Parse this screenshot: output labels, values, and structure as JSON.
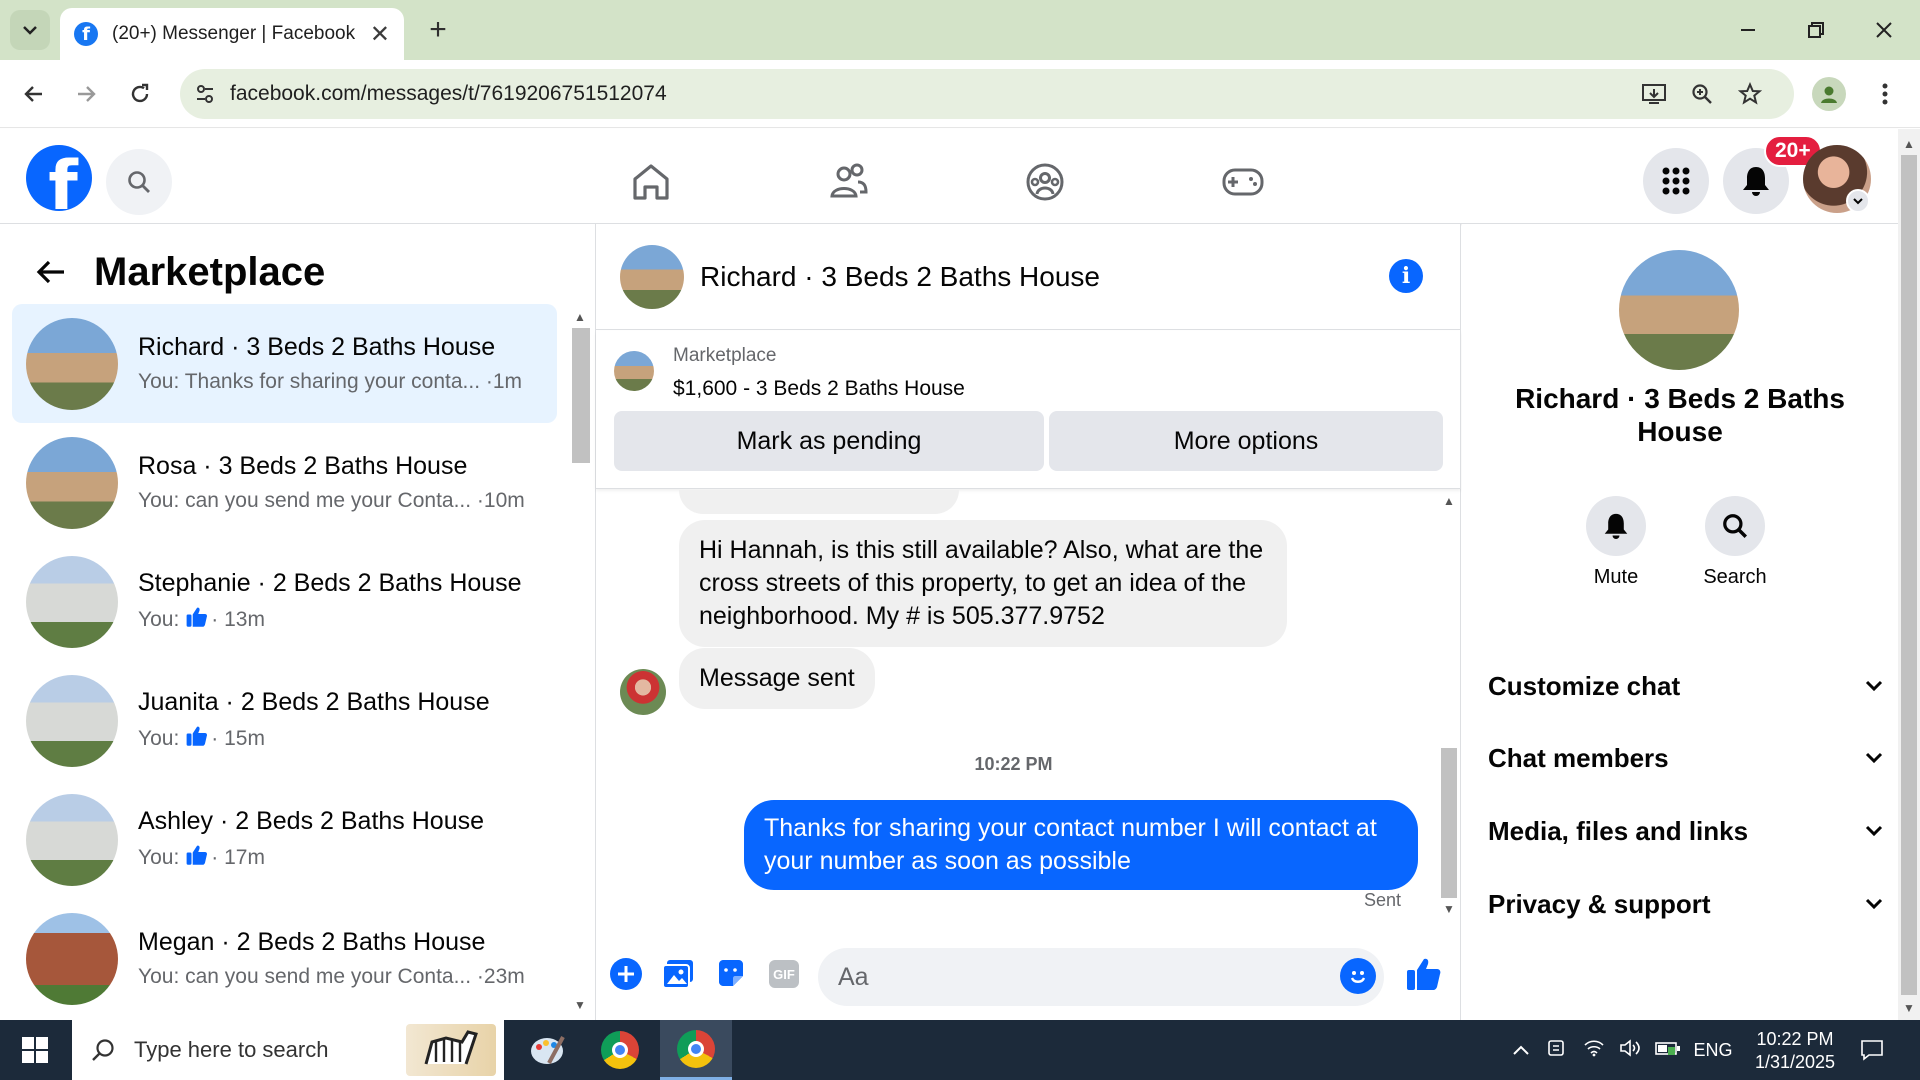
{
  "browser": {
    "tab_title": "(20+) Messenger | Facebook",
    "url": "facebook.com/messages/t/7619206751512074"
  },
  "fb_header": {
    "notification_badge": "20+"
  },
  "left": {
    "title": "Marketplace",
    "chats": [
      {
        "name": "Richard · 3 Beds 2 Baths House",
        "snippet": "You: Thanks for sharing your conta... ·1m",
        "like": false,
        "active": true,
        "thumb": "house1"
      },
      {
        "name": "Rosa · 3 Beds 2 Baths House",
        "snippet": "You: can you send me your Conta... ·10m",
        "like": false,
        "active": false,
        "thumb": "house1"
      },
      {
        "name": "Stephanie · 2 Beds 2 Baths House",
        "prefix": "You:",
        "suffix": "· 13m",
        "like": true,
        "active": false,
        "thumb": "house2"
      },
      {
        "name": "Juanita · 2 Beds 2 Baths House",
        "prefix": "You:",
        "suffix": "· 15m",
        "like": true,
        "active": false,
        "thumb": "house2"
      },
      {
        "name": "Ashley · 2 Beds 2 Baths House",
        "prefix": "You:",
        "suffix": "· 17m",
        "like": true,
        "active": false,
        "thumb": "house2"
      },
      {
        "name": "Megan · 2 Beds 2 Baths House",
        "snippet": "You: can you send me your Conta... ·23m",
        "like": false,
        "active": false,
        "thumb": "house3"
      }
    ]
  },
  "conversation": {
    "title": "Richard · 3 Beds 2 Baths House",
    "listing_source": "Marketplace",
    "listing_title": "$1,600 - 3 Beds 2 Baths House",
    "mark_pending": "Mark as pending",
    "more_options": "More options",
    "messages": {
      "incoming_1": "Hi Hannah, is this still available? Also, what are the cross streets of this property, to get an idea of the neighborhood. My # is 505.377.9752",
      "incoming_2": "Message sent",
      "timestamp": "10:22 PM",
      "outgoing_1": "Thanks for sharing your contact number I will contact at your number as soon as possible",
      "status": "Sent"
    },
    "composer_placeholder": "Aa",
    "gif_label": "GIF"
  },
  "details": {
    "name": "Richard · 3 Beds 2 Baths House",
    "actions": [
      "Mute",
      "Search"
    ],
    "sections": [
      "Customize chat",
      "Chat members",
      "Media, files and links",
      "Privacy & support"
    ]
  },
  "taskbar": {
    "search_placeholder": "Type here to search",
    "language": "ENG",
    "time": "10:22 PM",
    "date": "1/31/2025"
  },
  "colors": {
    "fb_blue": "#0866ff",
    "active_chat_bg": "#e7f3ff",
    "incoming_bubble": "#f0f0f0",
    "chrome_tabstrip": "#d3e3c8",
    "taskbar": "#1c2a3a"
  }
}
